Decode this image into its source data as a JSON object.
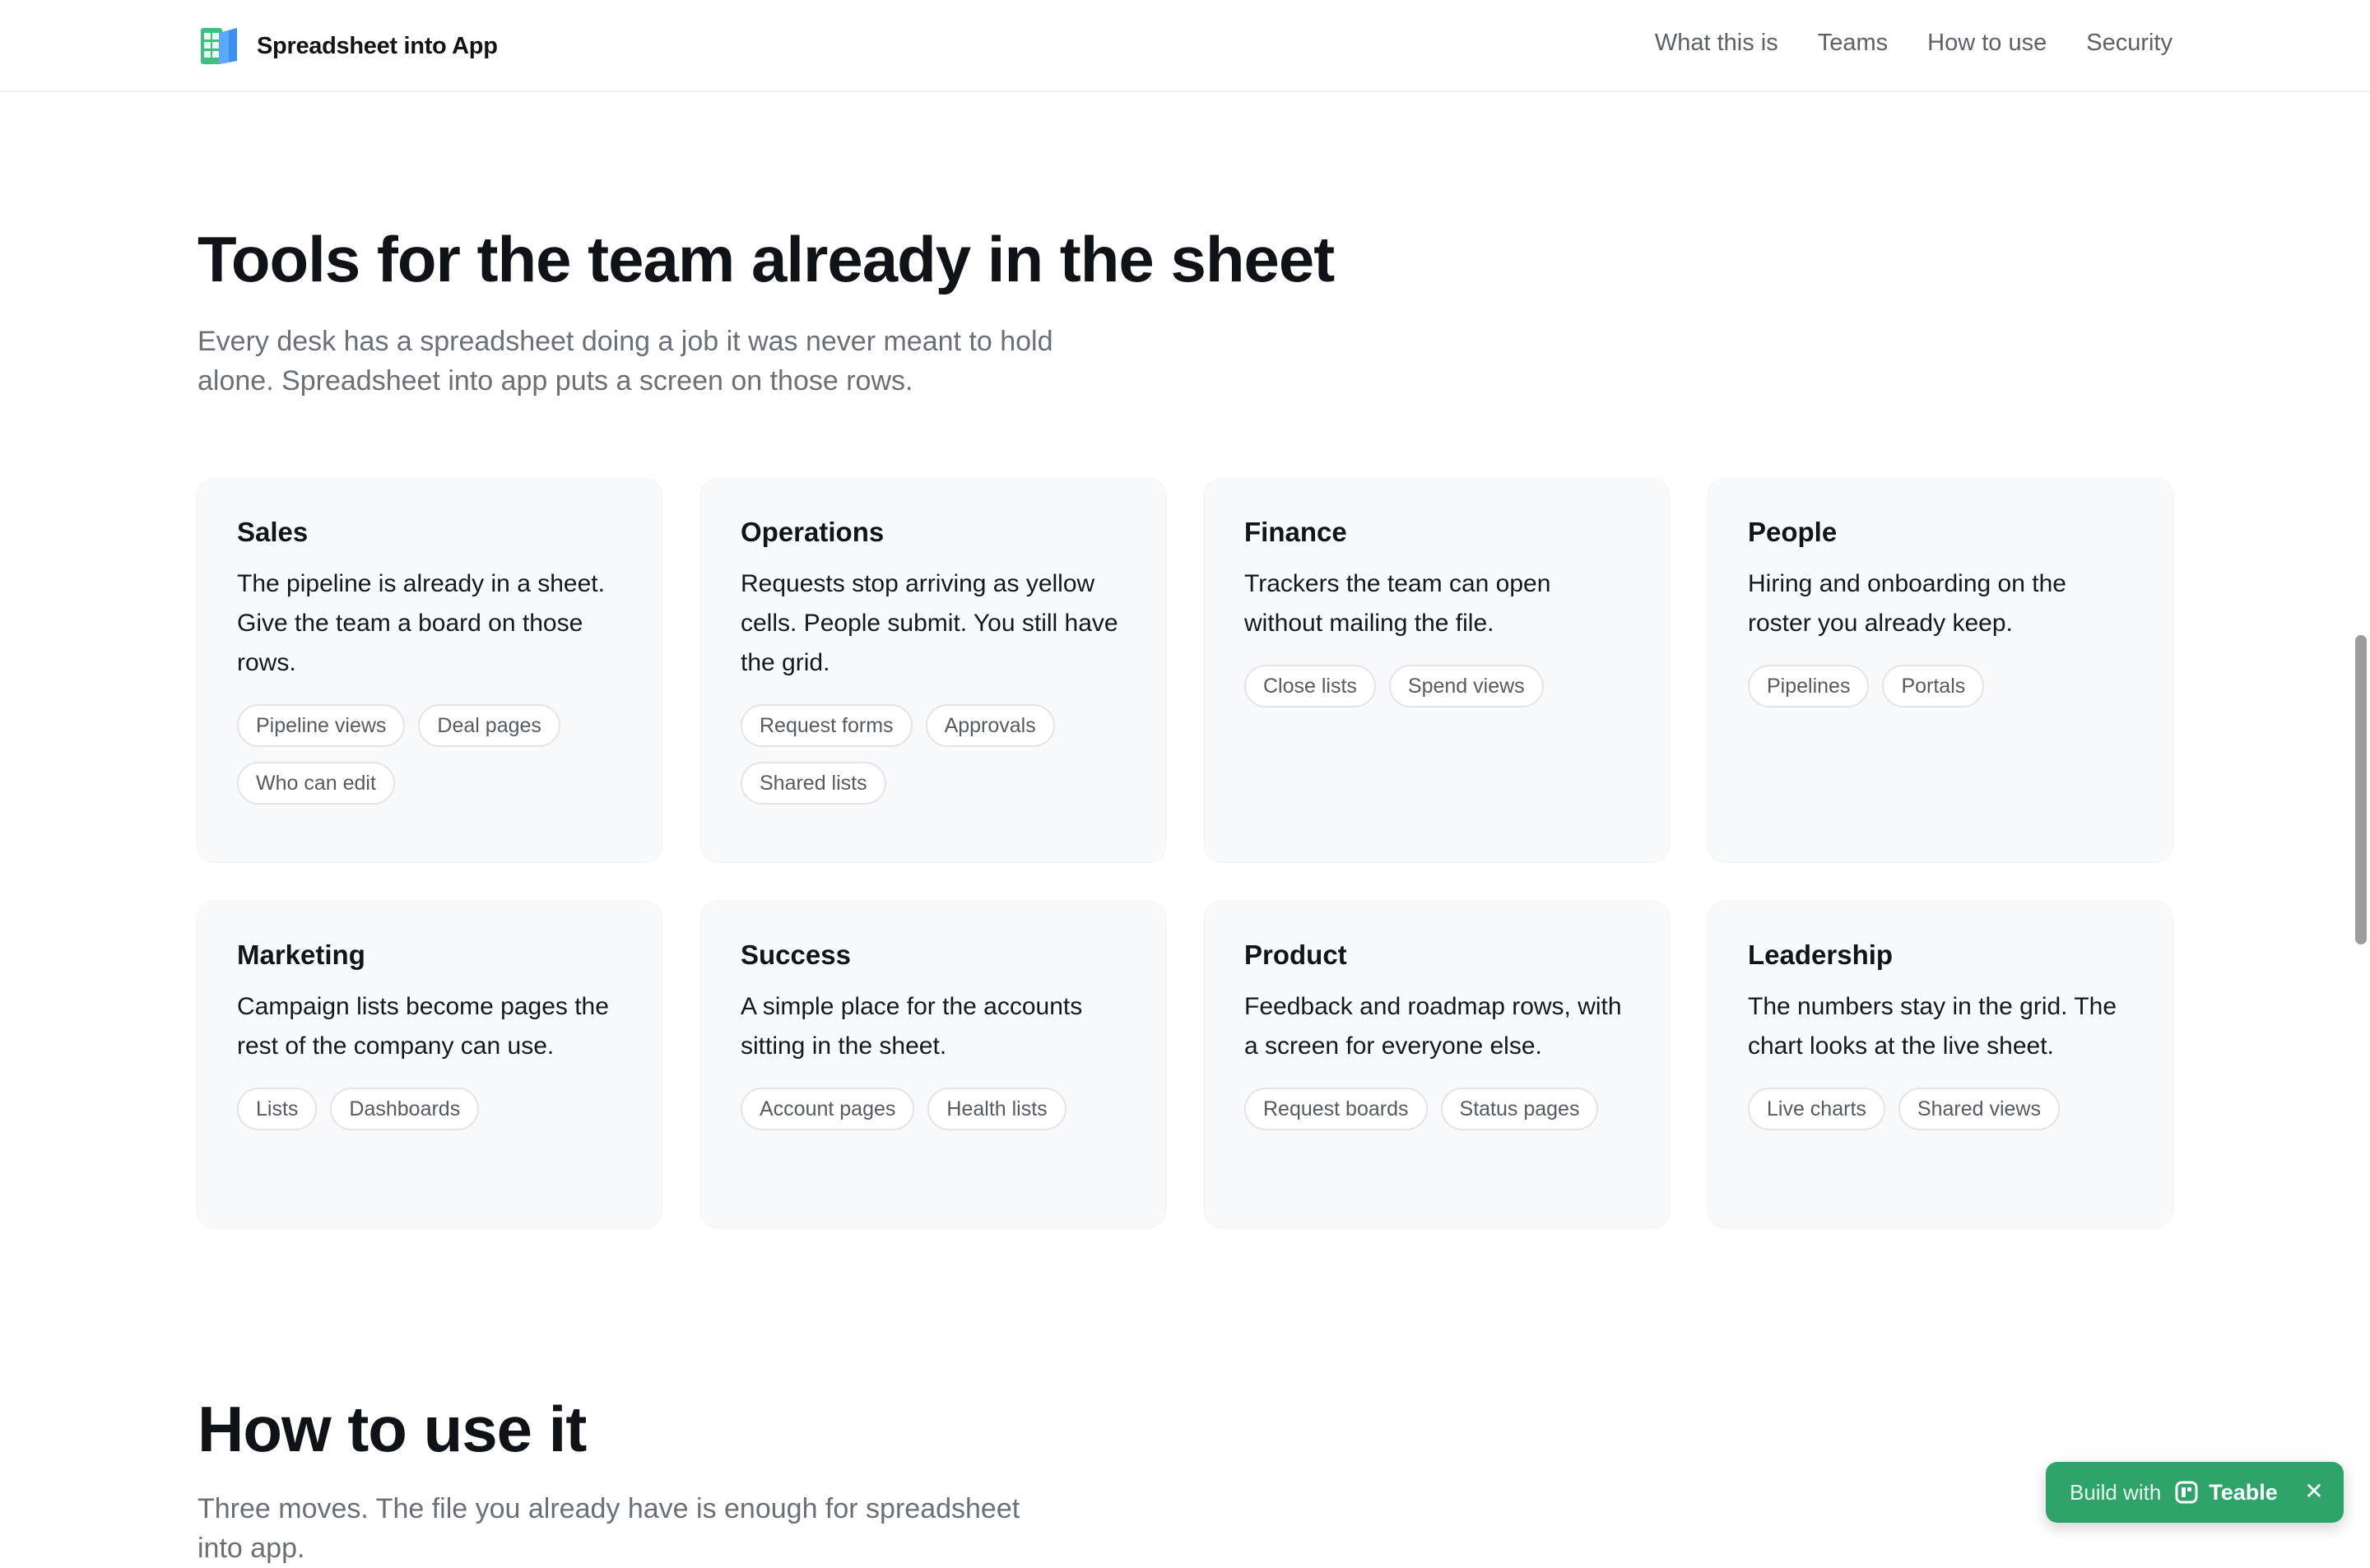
{
  "nav": {
    "brand": "Spreadsheet into App",
    "brand_icon": "spreadsheet-app-icon",
    "links": [
      "What this is",
      "Teams",
      "How to use",
      "Security"
    ]
  },
  "teams": {
    "title": "Tools for the team already in the sheet",
    "subtitle": "Every desk has a spreadsheet doing a job it was never meant to hold alone. Spreadsheet into app puts a screen on those rows.",
    "cards": [
      {
        "title": "Sales",
        "desc": "The pipeline is already in a sheet. Give the team a board on those rows.",
        "tags": [
          "Pipeline views",
          "Deal pages",
          "Who can edit"
        ]
      },
      {
        "title": "Operations",
        "desc": "Requests stop arriving as yellow cells. People submit. You still have the grid.",
        "tags": [
          "Request forms",
          "Approvals",
          "Shared lists"
        ]
      },
      {
        "title": "Finance",
        "desc": "Trackers the team can open without mailing the file.",
        "tags": [
          "Close lists",
          "Spend views"
        ]
      },
      {
        "title": "People",
        "desc": "Hiring and onboarding on the roster you already keep.",
        "tags": [
          "Pipelines",
          "Portals"
        ]
      },
      {
        "title": "Marketing",
        "desc": "Campaign lists become pages the rest of the company can use.",
        "tags": [
          "Lists",
          "Dashboards"
        ]
      },
      {
        "title": "Success",
        "desc": "A simple place for the accounts sitting in the sheet.",
        "tags": [
          "Account pages",
          "Health lists"
        ]
      },
      {
        "title": "Product",
        "desc": "Feedback and roadmap rows, with a screen for everyone else.",
        "tags": [
          "Request boards",
          "Status pages"
        ]
      },
      {
        "title": "Leadership",
        "desc": "The numbers stay in the grid. The chart looks at the live sheet.",
        "tags": [
          "Live charts",
          "Shared views"
        ]
      }
    ]
  },
  "how": {
    "title": "How to use it",
    "subtitle": "Three moves. The file you already have is enough for spreadsheet into app."
  },
  "badge": {
    "prefix": "Build with",
    "brand": "Teable",
    "close": "✕",
    "color": "#2ea46b"
  }
}
